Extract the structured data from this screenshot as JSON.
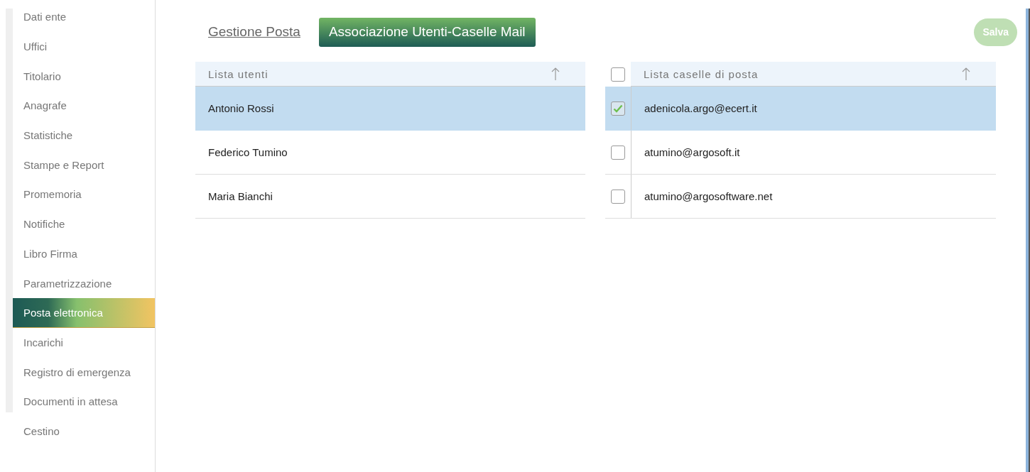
{
  "sidebar": {
    "items": [
      {
        "label": "Dati ente",
        "selected": false
      },
      {
        "label": "Uffici",
        "selected": false
      },
      {
        "label": "Titolario",
        "selected": false
      },
      {
        "label": "Anagrafe",
        "selected": false
      },
      {
        "label": "Statistiche",
        "selected": false
      },
      {
        "label": "Stampe e Report",
        "selected": false
      },
      {
        "label": "Promemoria",
        "selected": false
      },
      {
        "label": "Notifiche",
        "selected": false
      },
      {
        "label": "Libro Firma",
        "selected": false
      },
      {
        "label": "Parametrizzazione",
        "selected": false
      },
      {
        "label": "Posta elettronica",
        "selected": true
      },
      {
        "label": "Incarichi",
        "selected": false
      },
      {
        "label": "Registro di emergenza",
        "selected": false
      },
      {
        "label": "Documenti in attesa",
        "selected": false
      },
      {
        "label": "Cestino",
        "selected": false
      }
    ]
  },
  "tabs": [
    {
      "label": "Gestione Posta",
      "selected": false
    },
    {
      "label": "Associazione Utenti-Caselle Mail",
      "selected": true
    }
  ],
  "save_button": {
    "label": "Salva",
    "disabled": true
  },
  "users_table": {
    "column": "Lista utenti",
    "rows": [
      {
        "name": "Antonio Rossi",
        "selected": true
      },
      {
        "name": "Federico Tumino",
        "selected": false
      },
      {
        "name": "Maria Bianchi",
        "selected": false
      }
    ]
  },
  "mailbox_table": {
    "column": "Lista caselle di posta",
    "all_checked": false,
    "rows": [
      {
        "address": "adenicola.argo@ecert.it",
        "checked": true,
        "selected": true
      },
      {
        "address": "atumino@argosoft.it",
        "checked": false,
        "selected": false
      },
      {
        "address": "atumino@argosoftware.net",
        "checked": false,
        "selected": false
      }
    ]
  }
}
